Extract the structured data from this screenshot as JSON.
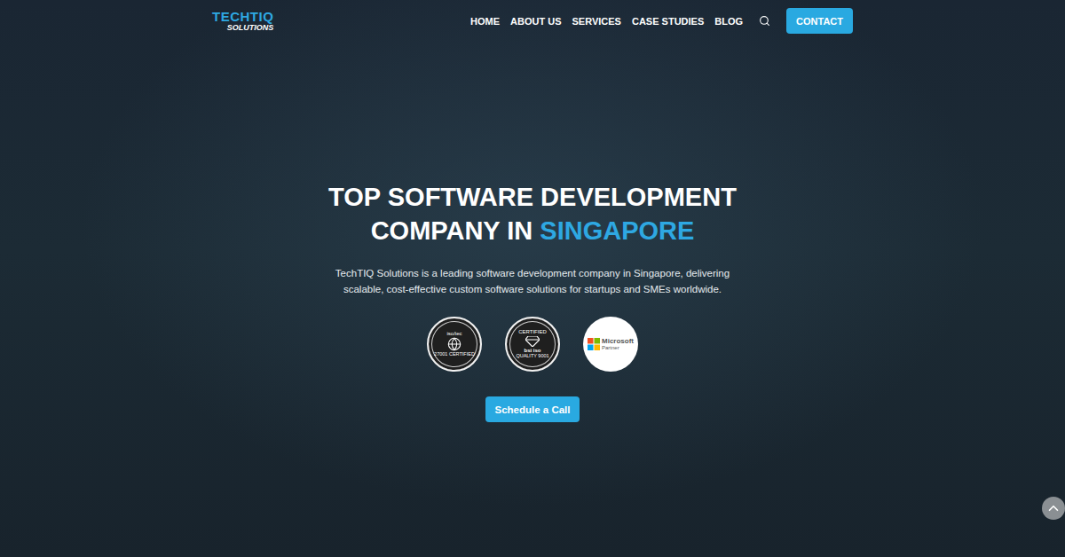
{
  "logo": {
    "primary": "TECHTIQ",
    "secondary": "SOLUTIONS"
  },
  "nav": {
    "items": [
      {
        "label": "HOME"
      },
      {
        "label": "ABOUT US"
      },
      {
        "label": "SERVICES"
      },
      {
        "label": "CASE STUDIES"
      },
      {
        "label": "BLOG"
      }
    ],
    "contact_button": "CONTACT"
  },
  "hero": {
    "title_line1": "TOP SOFTWARE DEVELOPMENT",
    "title_prefix": "COMPANY IN",
    "title_highlight": "SINGAPORE",
    "description": "TechTIQ Solutions is a leading software development company in Singapore, delivering scalable, cost-effective custom software solutions for startups and SMEs worldwide.",
    "badges": [
      {
        "kind": "iso",
        "top": "iso/iec",
        "middle": "",
        "bottom": "27001 CERTIFIED"
      },
      {
        "kind": "bsi",
        "top": "CERTIFIED",
        "middle": "bsi  iso",
        "bottom": "QUALITY 9001"
      },
      {
        "kind": "microsoft",
        "top": "",
        "middle": "Microsoft",
        "bottom": "Partner"
      }
    ],
    "cta": "Schedule a Call"
  }
}
